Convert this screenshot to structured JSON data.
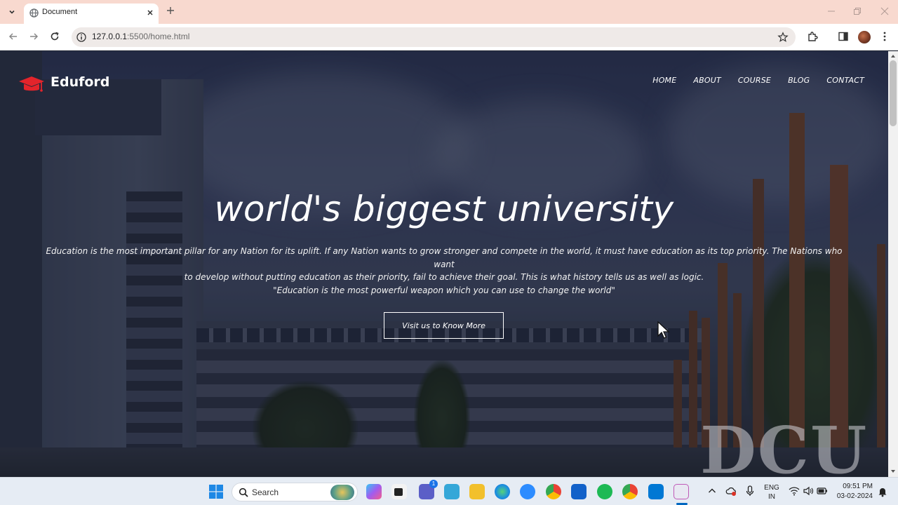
{
  "browser": {
    "tab_title": "Document",
    "url_host": "127.0.0.1",
    "url_rest": ":5500/home.html"
  },
  "site": {
    "brand": "Eduford",
    "nav": [
      "HOME",
      "ABOUT",
      "COURSE",
      "BLOG",
      "CONTACT"
    ],
    "hero_title": "world's biggest university",
    "hero_line1": "Education is the most important pillar for any Nation for its uplift. If any Nation wants to grow stronger and compete in the world, it must have education as its top priority. The Nations who want",
    "hero_line2": "to develop without putting education as their priority, fail to achieve their goal. This is what history tells us as well as logic.",
    "hero_line3": "\"Education is the most powerful weapon which you can use to change the world\"",
    "cta_label": "Visit us to Know More",
    "background_sign": "DCU"
  },
  "taskbar": {
    "search_label": "Search",
    "lang_top": "ENG",
    "lang_bottom": "IN",
    "time": "09:51 PM",
    "date": "03-02-2024",
    "teams_badge": "1"
  },
  "colors": {
    "tabbar": "#f8d9cf",
    "logo_red": "#e3242b",
    "overlay": "#141a2e"
  }
}
